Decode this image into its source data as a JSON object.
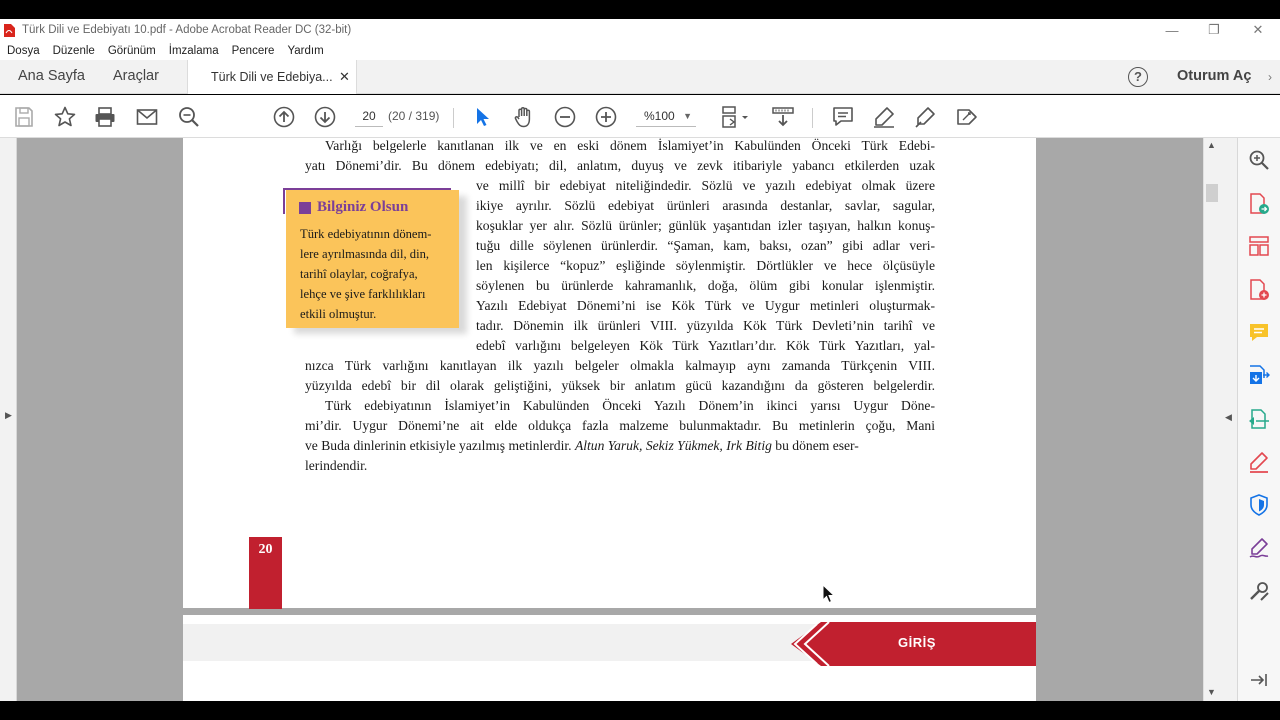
{
  "window": {
    "title": "Türk Dili ve Edebiyatı 10.pdf - Adobe Acrobat Reader DC (32-bit)"
  },
  "menu": [
    "Dosya",
    "Düzenle",
    "Görünüm",
    "İmzalama",
    "Pencere",
    "Yardım"
  ],
  "tabs": {
    "home": "Ana Sayfa",
    "tools": "Araçlar",
    "document": "Türk Dili ve Edebiya...",
    "signin": "Oturum Aç",
    "help": "?"
  },
  "toolbar": {
    "page_current": "20",
    "page_count": "(20 / 319)",
    "zoom": "%100"
  },
  "document": {
    "lines_top": [
      "Varlığı belgelerle kanıtlanan ilk ve en eski dönem İslamiyet’in Kabulünden Önceki Türk Edebi-",
      "yatı Dönemi’dir. Bu dönem edebiyatı; dil, anlatım, duyuş ve zevk itibariyle yabancı etkilerden uzak"
    ],
    "lines_right": [
      "ve millî bir edebiyat niteliğindedir. Sözlü ve yazılı edebiyat olmak üzere",
      "ikiye ayrılır. Sözlü edebiyat ürünleri arasında destanlar, savlar, sagular,",
      "koşuklar yer alır. Sözlü ürünler; günlük yaşantıdan izler taşıyan, halkın konuş-",
      "tuğu dille söylenen ürünlerdir. “Şaman, kam, baksı, ozan” gibi adlar veri-",
      "len kişilerce “kopuz” eşliğinde söylenmiştir. Dörtlükler ve hece ölçüsüyle",
      "söylenen bu ürünlerde kahramanlık, doğa, ölüm gibi konular işlenmiştir.",
      "Yazılı Edebiyat Dönemi’ni ise Kök Türk ve Uygur metinleri oluşturmak-",
      "tadır. Dönemin ilk ürünleri VIII. yüzyılda Kök Türk Devleti’nin tarihî ve",
      "edebî varlığını belgeleyen Kök Türk Yazıtları’dır. Kök Türk Yazıtları, yal-"
    ],
    "lines_full": [
      "nızca Türk varlığını kanıtlayan ilk yazılı belgeler olmakla kalmayıp aynı zamanda Türkçenin VIII.",
      "yüzyılda edebî bir dil olarak geliştiğini, yüksek bir anlatım gücü kazandığını da gösteren belgelerdir.",
      "Türk edebiyatının İslamiyet’in Kabulünden Önceki Yazılı Dönem’in ikinci yarısı Uygur Döne-",
      "mi’dir. Uygur Dönemi’ne ait elde oldukça fazla malzeme bulunmaktadır. Bu metinlerin çoğu, Mani"
    ],
    "line_mixed": {
      "before": "ve Buda dinlerinin etkisiyle yazılmış metinlerdir. ",
      "italic": "Altun Yaruk, Sekiz Yükmek, Irk Bitig",
      "after": " bu dönem eser-"
    },
    "line_last": "lerindendir.",
    "infobox": {
      "title": "Bilginiz Olsun",
      "lines": [
        "Türk edebiyatının dönem-",
        "lere ayrılmasında dil, din,",
        "tarihî olaylar, coğrafya,",
        "lehçe ve şive farklılıkları",
        "etkili olmuştur."
      ]
    },
    "page_number": "20",
    "next_section": "GİRİŞ"
  },
  "colors": {
    "accent_purple": "#7b3f98",
    "box_yellow": "#fbc45a",
    "brand_red": "#c1202f",
    "acrobat_blue": "#1473e6"
  }
}
